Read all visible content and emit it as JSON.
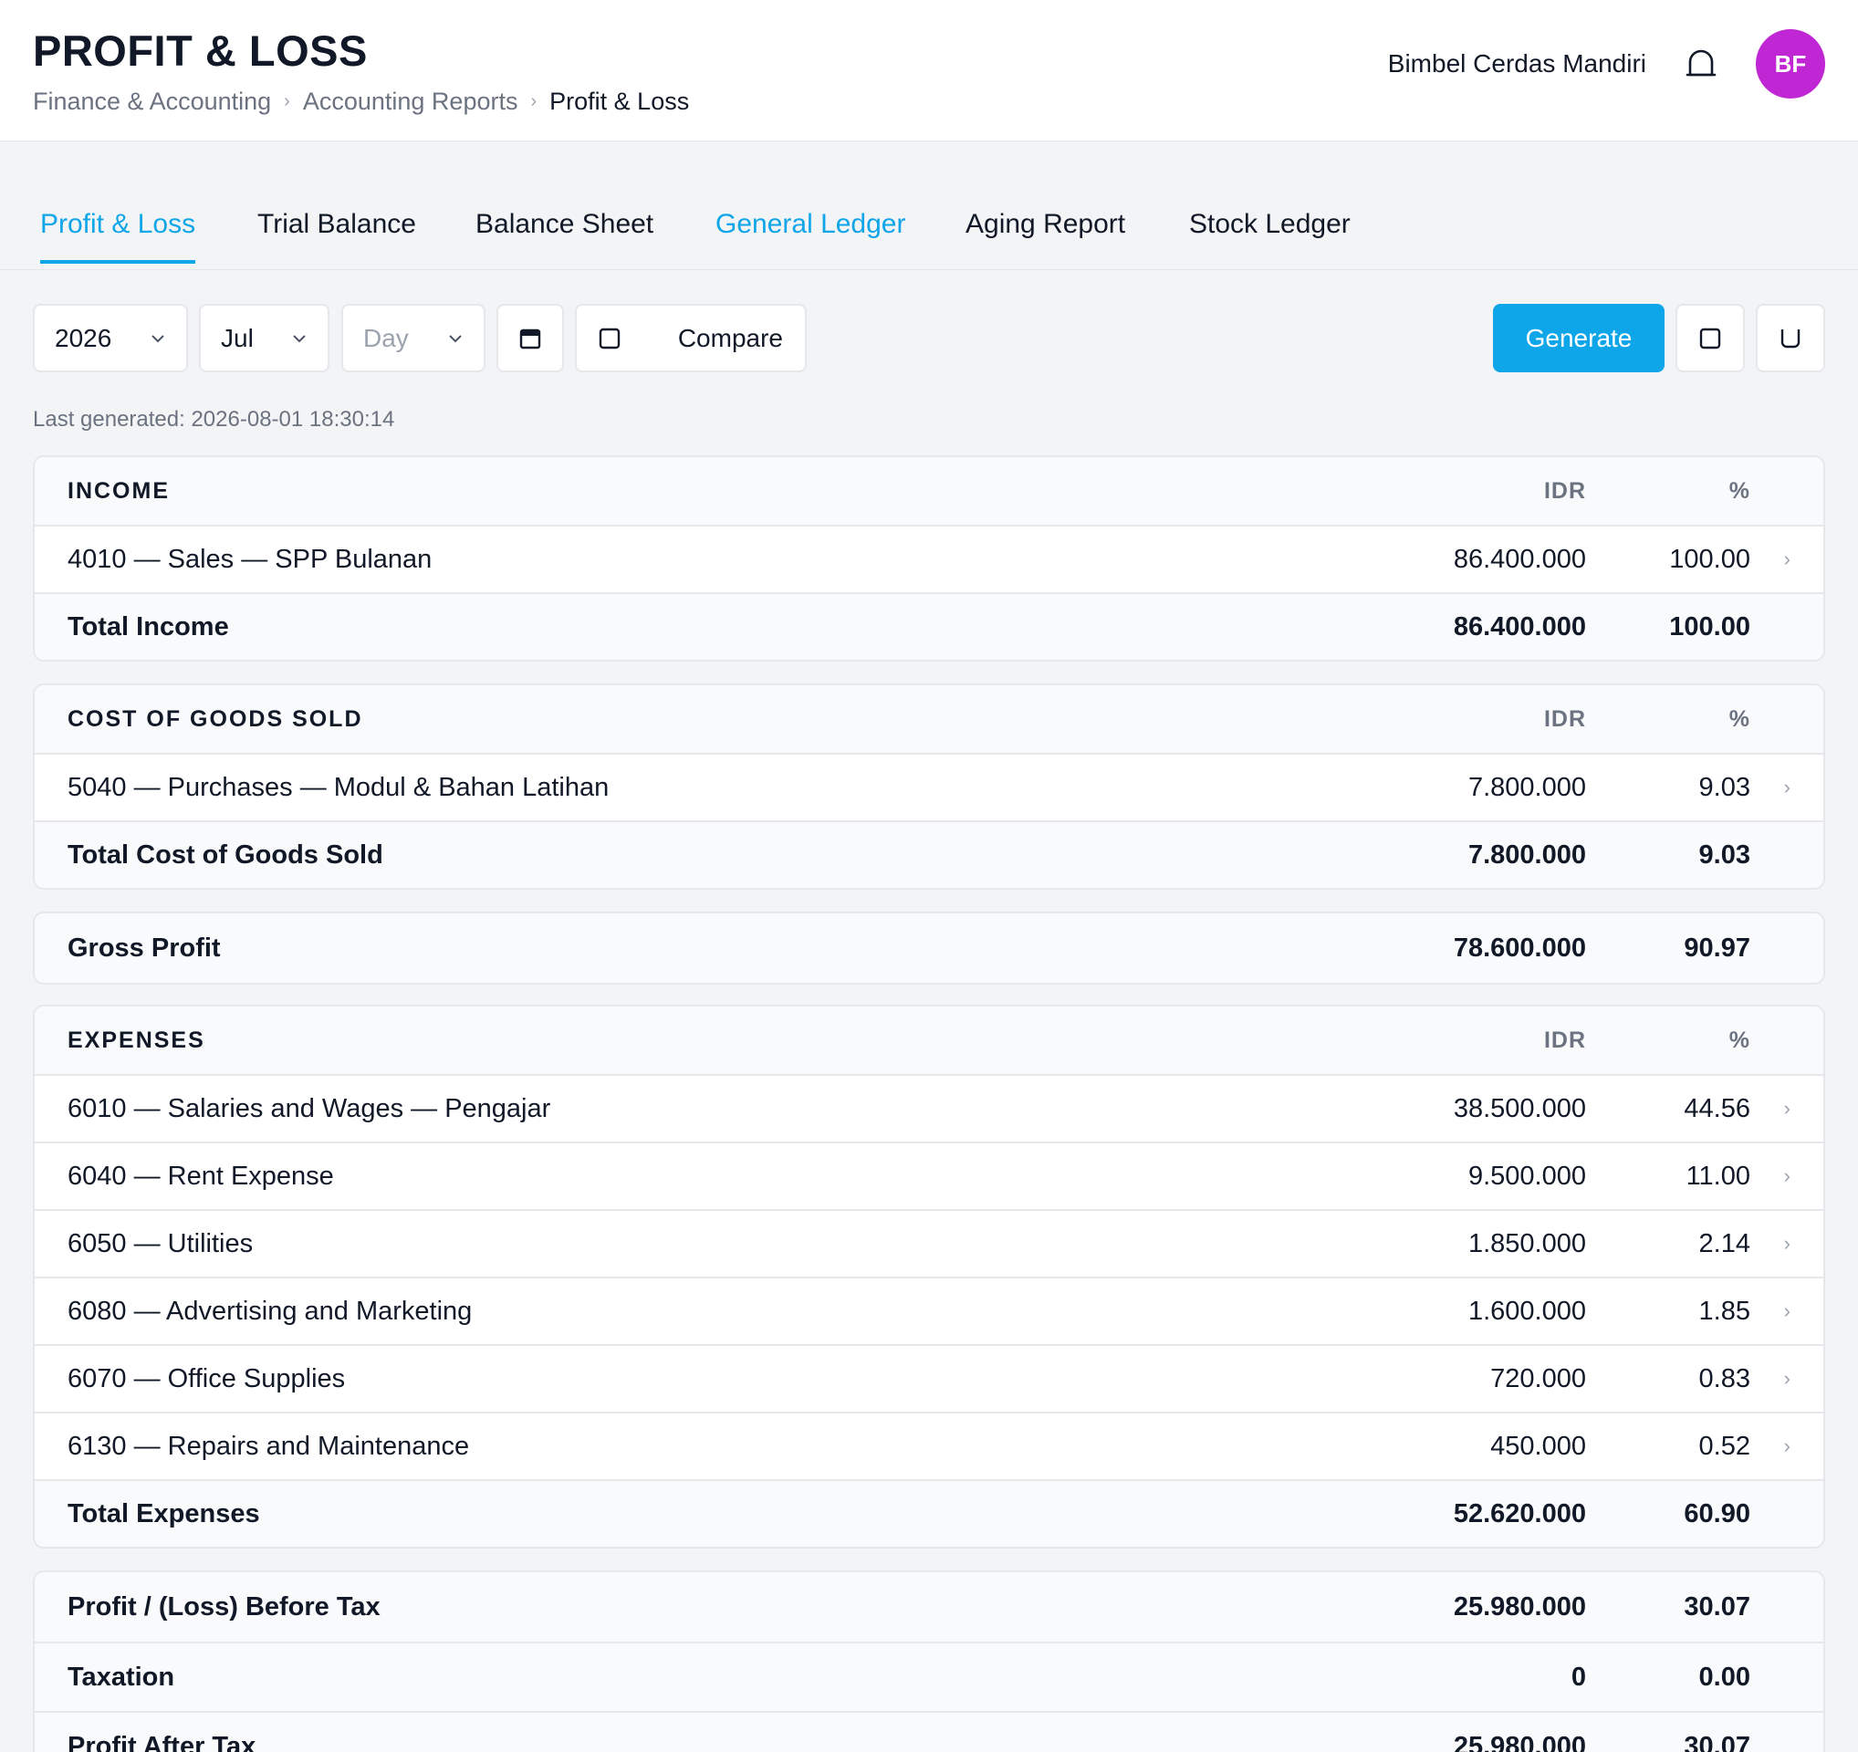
{
  "header": {
    "title": "PROFIT & LOSS",
    "breadcrumb": [
      "Finance & Accounting",
      "Accounting Reports",
      "Profit & Loss"
    ],
    "company": "Bimbel Cerdas Mandiri",
    "avatar_initials": "BF",
    "avatar_color": "#c026d3"
  },
  "tabs": [
    {
      "label": "Profit & Loss",
      "state": "active"
    },
    {
      "label": "Trial Balance",
      "state": "normal"
    },
    {
      "label": "Balance Sheet",
      "state": "normal"
    },
    {
      "label": "General Ledger",
      "state": "link"
    },
    {
      "label": "Aging Report",
      "state": "normal"
    },
    {
      "label": "Stock Ledger",
      "state": "normal"
    }
  ],
  "filters": {
    "year": "2026",
    "month": "Jul",
    "day_placeholder": "Day",
    "compare_label": "Compare",
    "generate_label": "Generate"
  },
  "last_generated": "Last generated: 2026-08-01 18:30:14",
  "columns": {
    "amount": "IDR",
    "percent": "%"
  },
  "income": {
    "title": "INCOME",
    "rows": [
      {
        "label": "4010 — Sales — SPP Bulanan",
        "amount": "86.400.000",
        "pct": "100.00"
      }
    ],
    "total": {
      "label": "Total Income",
      "amount": "86.400.000",
      "pct": "100.00"
    }
  },
  "cogs": {
    "title": "COST OF GOODS SOLD",
    "rows": [
      {
        "label": "5040 — Purchases — Modul & Bahan Latihan",
        "amount": "7.800.000",
        "pct": "9.03"
      }
    ],
    "total": {
      "label": "Total Cost of Goods Sold",
      "amount": "7.800.000",
      "pct": "9.03"
    }
  },
  "gross_profit": {
    "label": "Gross Profit",
    "amount": "78.600.000",
    "pct": "90.97"
  },
  "expenses": {
    "title": "EXPENSES",
    "rows": [
      {
        "label": "6010 — Salaries and Wages — Pengajar",
        "amount": "38.500.000",
        "pct": "44.56"
      },
      {
        "label": "6040 — Rent Expense",
        "amount": "9.500.000",
        "pct": "11.00"
      },
      {
        "label": "6050 — Utilities",
        "amount": "1.850.000",
        "pct": "2.14"
      },
      {
        "label": "6080 — Advertising and Marketing",
        "amount": "1.600.000",
        "pct": "1.85"
      },
      {
        "label": "6070 — Office Supplies",
        "amount": "720.000",
        "pct": "0.83"
      },
      {
        "label": "6130 — Repairs and Maintenance",
        "amount": "450.000",
        "pct": "0.52"
      }
    ],
    "total": {
      "label": "Total Expenses",
      "amount": "52.620.000",
      "pct": "60.90"
    }
  },
  "summary": {
    "before_tax": {
      "label": "Profit / (Loss) Before Tax",
      "amount": "25.980.000",
      "pct": "30.07"
    },
    "tax": {
      "label": "Taxation",
      "amount": "0",
      "pct": "0.00"
    },
    "after_tax": {
      "label": "Profit After Tax",
      "amount": "25.980.000",
      "pct": "30.07"
    }
  },
  "colors": {
    "accent": "#0ea5e9",
    "border": "#e5e7eb",
    "muted": "#6b7280"
  }
}
